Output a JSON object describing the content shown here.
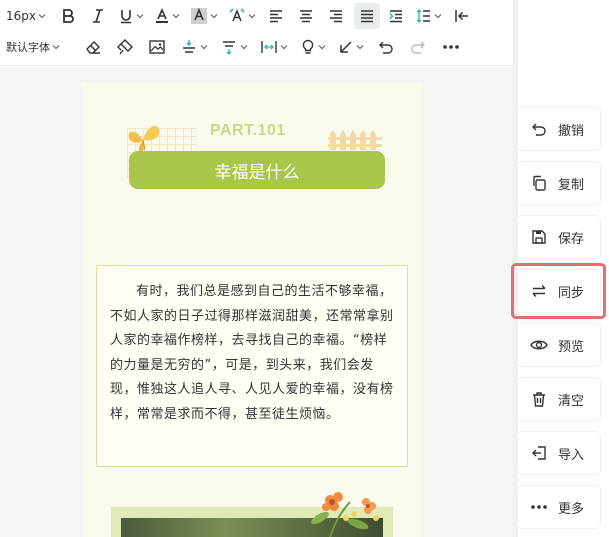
{
  "toolbar": {
    "font_size": "16px",
    "font_family": "默认字体",
    "row1_icons": [
      "bold-icon",
      "italic-icon",
      "underline-icon",
      "font-color-icon",
      "background-color-icon",
      "clear-format-icon",
      "align-left-icon",
      "align-center-icon",
      "align-right-icon",
      "justify-icon",
      "indent-icon",
      "line-height-icon",
      "exit-icon"
    ],
    "row2_icons": [
      "eraser-icon",
      "format-painter-icon",
      "image-icon",
      "spacing-before-icon",
      "spacing-after-icon",
      "letter-spacing-icon",
      "bulb-icon",
      "arrow-icon",
      "undo-icon",
      "redo-icon",
      "more-icon"
    ]
  },
  "article": {
    "part_label": "PART.101",
    "title": "幸福是什么",
    "paragraph": "有时，我们总是感到自己的生活不够幸福，不如人家的日子过得那样滋润甜美，还常常拿别人家的幸福作榜样，去寻找自己的幸福。“榜样的力量是无穷的”，可是，到头来，我们会发现，惟独这人追人寻、人见人爱的幸福，没有榜样，常常是求而不得，甚至徒生烦恼。"
  },
  "side_actions": [
    {
      "label": "撤销",
      "icon": "undo-icon"
    },
    {
      "label": "复制",
      "icon": "copy-icon"
    },
    {
      "label": "保存",
      "icon": "save-icon"
    },
    {
      "label": "同步",
      "icon": "sync-icon"
    },
    {
      "label": "预览",
      "icon": "eye-icon"
    },
    {
      "label": "清空",
      "icon": "trash-icon"
    },
    {
      "label": "导入",
      "icon": "import-icon"
    },
    {
      "label": "更多",
      "icon": "more-icon"
    }
  ],
  "colors": {
    "accent_green": "#a9c64a",
    "highlight_red": "#e96b73",
    "article_bg": "#fbfbed"
  }
}
